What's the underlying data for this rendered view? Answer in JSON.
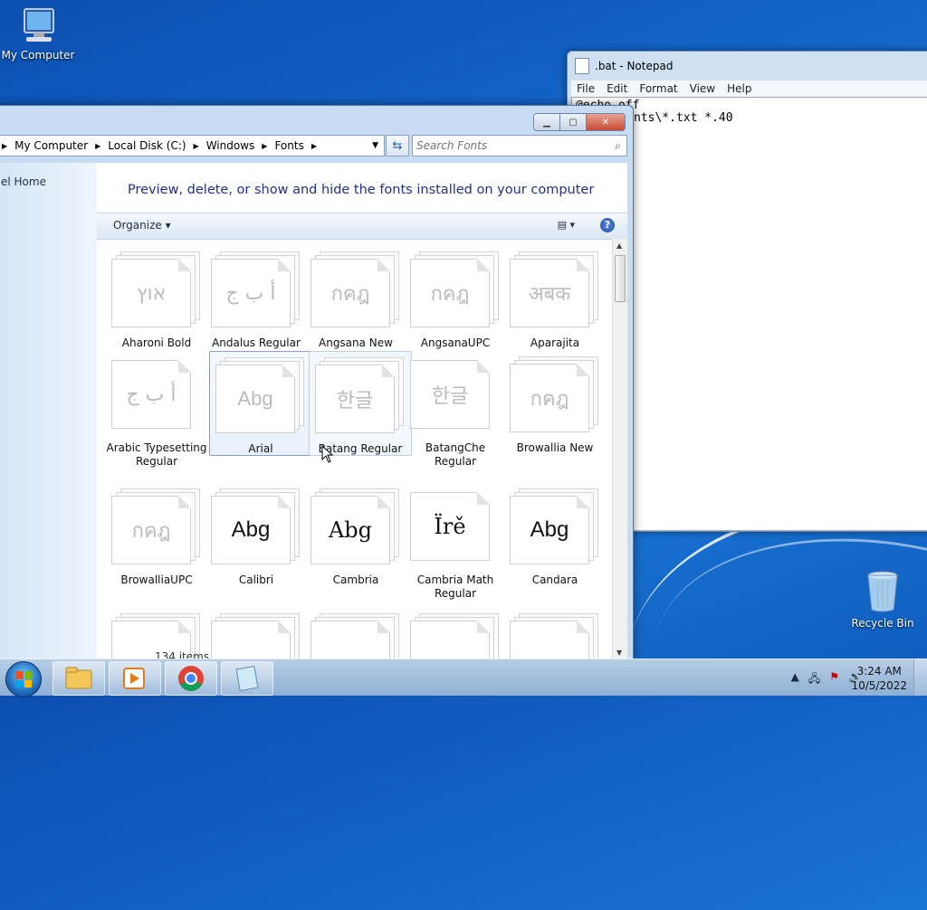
{
  "desktop": {
    "icons": [
      {
        "label": "My Computer",
        "icon": "computer-icon"
      },
      {
        "label": "Recycle Bin",
        "icon": "recycle-bin-icon"
      }
    ]
  },
  "notepad": {
    "title": ".bat - Notepad",
    "menu": [
      "File",
      "Edit",
      "Format",
      "View",
      "Help"
    ],
    "line1": "@echo off",
    "line2": "nts\\*.txt *.40"
  },
  "explorer": {
    "breadcrumb": [
      "My Computer",
      "Local Disk (C:)",
      "Windows",
      "Fonts"
    ],
    "search_placeholder": "Search Fonts",
    "left_item": "el Home",
    "heading": "Preview, delete, or show and hide the fonts installed on your computer",
    "organize": "Organize",
    "status": "134 items",
    "fonts": [
      {
        "name": "Aharoni Bold",
        "sample": "אוץ",
        "style": "light"
      },
      {
        "name": "Andalus Regular",
        "sample": "أ ب ج",
        "style": "light"
      },
      {
        "name": "Angsana New",
        "sample": "กคฎ",
        "style": "light"
      },
      {
        "name": "AngsanaUPC",
        "sample": "กคฎ",
        "style": "light"
      },
      {
        "name": "Aparajita",
        "sample": "अबक",
        "style": "light"
      },
      {
        "name": "Arabic Typesetting Regular",
        "sample": "أ ب ج",
        "style": "light"
      },
      {
        "name": "Arial",
        "sample": "Abg",
        "style": "light"
      },
      {
        "name": "Batang Regular",
        "sample": "한글",
        "style": "light"
      },
      {
        "name": "BatangChe Regular",
        "sample": "한글",
        "style": "light"
      },
      {
        "name": "Browallia New",
        "sample": "กคฎ",
        "style": "light"
      },
      {
        "name": "BrowalliaUPC",
        "sample": "กคฎ",
        "style": "light"
      },
      {
        "name": "Calibri",
        "sample": "Abg",
        "style": "dark"
      },
      {
        "name": "Cambria",
        "sample": "Abg",
        "style": "dark"
      },
      {
        "name": "Cambria Math Regular",
        "sample": "Ïrě",
        "style": "dark"
      },
      {
        "name": "Candara",
        "sample": "Abg",
        "style": "dark"
      }
    ]
  },
  "taskbar": {
    "time": "3:24 AM",
    "date": "10/5/2022",
    "apps": [
      "explorer-icon",
      "media-player-icon",
      "chrome-icon",
      "notepad-icon"
    ]
  }
}
